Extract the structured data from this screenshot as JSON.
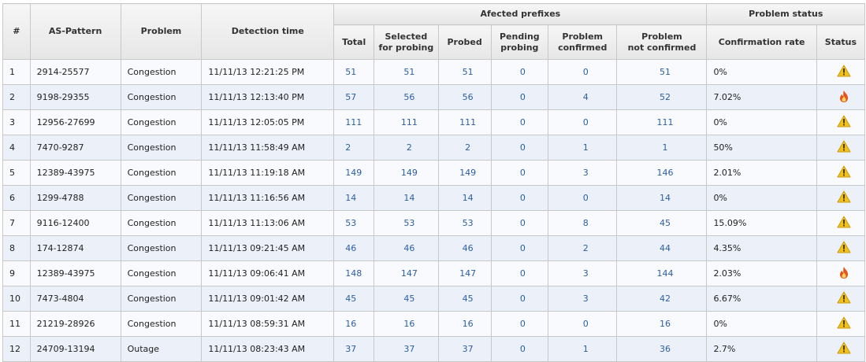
{
  "headers": {
    "index": "#",
    "as_pattern": "AS-Pattern",
    "problem": "Problem",
    "detection_time": "Detection time",
    "affected_prefixes": "Afected prefixes",
    "total": "Total",
    "selected_for_probing": [
      "Selected",
      "for probing"
    ],
    "probed": "Probed",
    "pending_probing": [
      "Pending",
      "probing"
    ],
    "problem_confirmed": [
      "Problem",
      "confirmed"
    ],
    "problem_not_confirmed": [
      "Problem",
      "not confirmed"
    ],
    "problem_status": "Problem status",
    "confirmation_rate": "Confirmation rate",
    "status": "Status"
  },
  "rows": [
    {
      "index": "1",
      "as_pattern": "2914-25577",
      "problem": "Congestion",
      "detection_time": "11/11/13 12:21:25 PM",
      "total": "51",
      "selected": "51",
      "probed": "51",
      "pending": "0",
      "confirmed": "0",
      "not_confirmed": "51",
      "confirmation_rate": "0%",
      "status_icon": "warning-icon"
    },
    {
      "index": "2",
      "as_pattern": "9198-29355",
      "problem": "Congestion",
      "detection_time": "11/11/13 12:13:40 PM",
      "total": "57",
      "selected": "56",
      "probed": "56",
      "pending": "0",
      "confirmed": "4",
      "not_confirmed": "52",
      "confirmation_rate": "7.02%",
      "status_icon": "fire-icon"
    },
    {
      "index": "3",
      "as_pattern": "12956-27699",
      "problem": "Congestion",
      "detection_time": "11/11/13 12:05:05 PM",
      "total": "111",
      "selected": "111",
      "probed": "111",
      "pending": "0",
      "confirmed": "0",
      "not_confirmed": "111",
      "confirmation_rate": "0%",
      "status_icon": "warning-icon"
    },
    {
      "index": "4",
      "as_pattern": "7470-9287",
      "problem": "Congestion",
      "detection_time": "11/11/13 11:58:49 AM",
      "total": "2",
      "selected": "2",
      "probed": "2",
      "pending": "0",
      "confirmed": "1",
      "not_confirmed": "1",
      "confirmation_rate": "50%",
      "status_icon": "warning-icon"
    },
    {
      "index": "5",
      "as_pattern": "12389-43975",
      "problem": "Congestion",
      "detection_time": "11/11/13 11:19:18 AM",
      "total": "149",
      "selected": "149",
      "probed": "149",
      "pending": "0",
      "confirmed": "3",
      "not_confirmed": "146",
      "confirmation_rate": "2.01%",
      "status_icon": "warning-icon"
    },
    {
      "index": "6",
      "as_pattern": "1299-4788",
      "problem": "Congestion",
      "detection_time": "11/11/13 11:16:56 AM",
      "total": "14",
      "selected": "14",
      "probed": "14",
      "pending": "0",
      "confirmed": "0",
      "not_confirmed": "14",
      "confirmation_rate": "0%",
      "status_icon": "warning-icon"
    },
    {
      "index": "7",
      "as_pattern": "9116-12400",
      "problem": "Congestion",
      "detection_time": "11/11/13 11:13:06 AM",
      "total": "53",
      "selected": "53",
      "probed": "53",
      "pending": "0",
      "confirmed": "8",
      "not_confirmed": "45",
      "confirmation_rate": "15.09%",
      "status_icon": "warning-icon"
    },
    {
      "index": "8",
      "as_pattern": "174-12874",
      "problem": "Congestion",
      "detection_time": "11/11/13 09:21:45 AM",
      "total": "46",
      "selected": "46",
      "probed": "46",
      "pending": "0",
      "confirmed": "2",
      "not_confirmed": "44",
      "confirmation_rate": "4.35%",
      "status_icon": "warning-icon"
    },
    {
      "index": "9",
      "as_pattern": "12389-43975",
      "problem": "Congestion",
      "detection_time": "11/11/13 09:06:41 AM",
      "total": "148",
      "selected": "147",
      "probed": "147",
      "pending": "0",
      "confirmed": "3",
      "not_confirmed": "144",
      "confirmation_rate": "2.03%",
      "status_icon": "fire-icon"
    },
    {
      "index": "10",
      "as_pattern": "7473-4804",
      "problem": "Congestion",
      "detection_time": "11/11/13 09:01:42 AM",
      "total": "45",
      "selected": "45",
      "probed": "45",
      "pending": "0",
      "confirmed": "3",
      "not_confirmed": "42",
      "confirmation_rate": "6.67%",
      "status_icon": "warning-icon"
    },
    {
      "index": "11",
      "as_pattern": "21219-28926",
      "problem": "Congestion",
      "detection_time": "11/11/13 08:59:31 AM",
      "total": "16",
      "selected": "16",
      "probed": "16",
      "pending": "0",
      "confirmed": "0",
      "not_confirmed": "16",
      "confirmation_rate": "0%",
      "status_icon": "warning-icon"
    },
    {
      "index": "12",
      "as_pattern": "24709-13194",
      "problem": "Outage",
      "detection_time": "11/11/13 08:23:43 AM",
      "total": "37",
      "selected": "37",
      "probed": "37",
      "pending": "0",
      "confirmed": "1",
      "not_confirmed": "36",
      "confirmation_rate": "2.7%",
      "status_icon": "warning-icon"
    }
  ],
  "colors": {
    "link_blue": "#2b5ea6",
    "row_stripe": "#ecf1f9",
    "warning_yellow": "#f2c21b",
    "fire_orange": "#e8531a"
  }
}
